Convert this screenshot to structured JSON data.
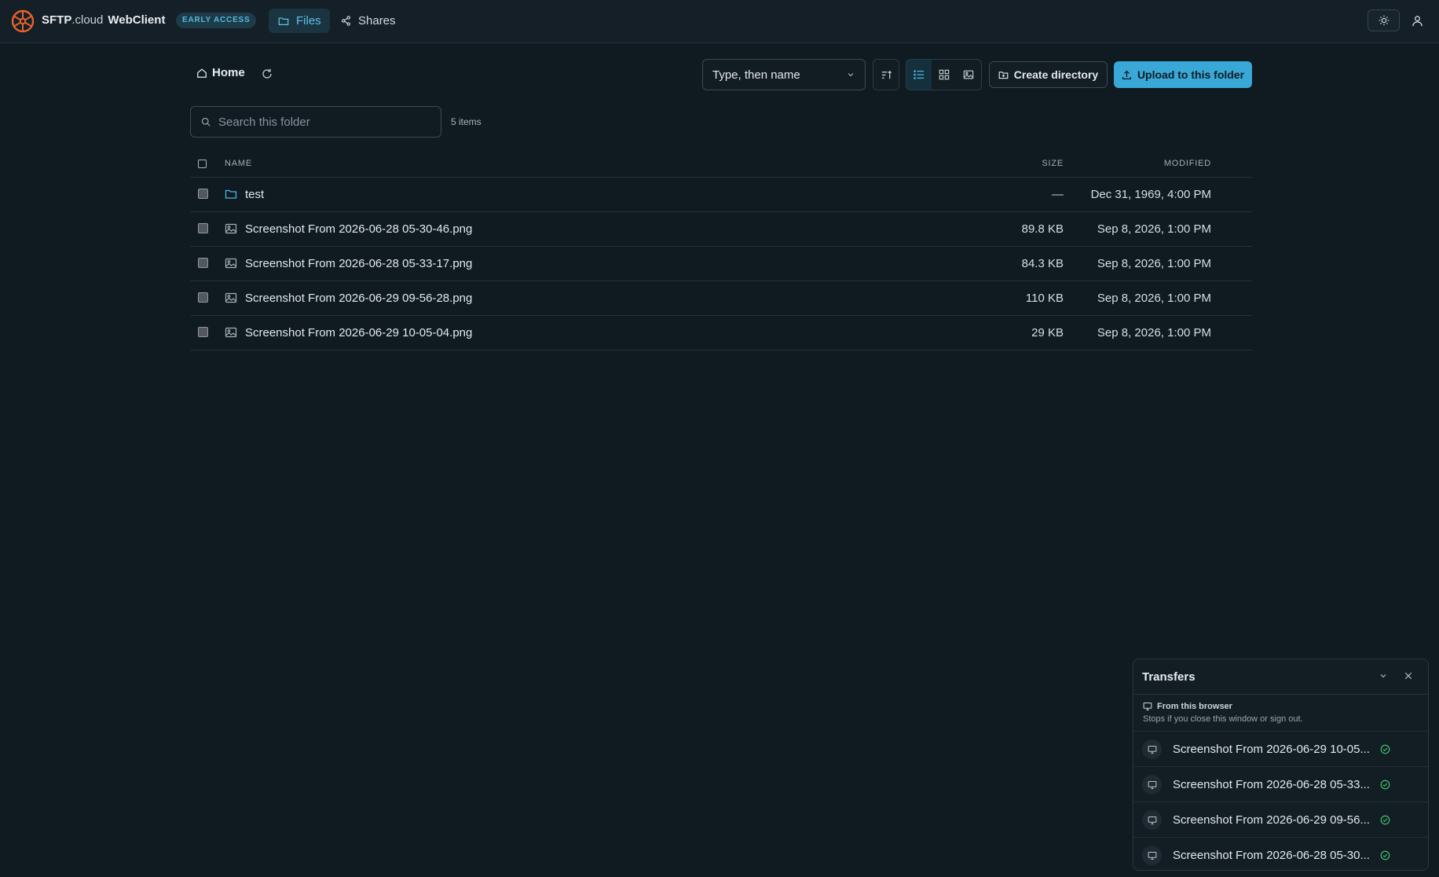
{
  "header": {
    "brand_bold": "SFTP",
    "brand_rest": ".cloud",
    "app_name": "WebClient",
    "badge": "EARLY ACCESS",
    "nav": {
      "files": "Files",
      "shares": "Shares"
    }
  },
  "toolbar": {
    "breadcrumb_home": "Home",
    "sort_value": "Type, then name",
    "create_directory": "Create directory",
    "upload": "Upload to this folder",
    "view_modes": [
      "list",
      "grid",
      "gallery"
    ],
    "active_view": "list"
  },
  "search": {
    "placeholder": "Search this folder",
    "item_count": "5 items"
  },
  "table": {
    "columns": {
      "name": "NAME",
      "size": "SIZE",
      "modified": "MODIFIED"
    },
    "rows": [
      {
        "type": "folder",
        "name": "test",
        "size": "—",
        "modified": "Dec 31, 1969, 4:00 PM"
      },
      {
        "type": "image",
        "name": "Screenshot From 2026-06-28 05-30-46.png",
        "size": "89.8 KB",
        "modified": "Sep 8, 2026, 1:00 PM"
      },
      {
        "type": "image",
        "name": "Screenshot From 2026-06-28 05-33-17.png",
        "size": "84.3 KB",
        "modified": "Sep 8, 2026, 1:00 PM"
      },
      {
        "type": "image",
        "name": "Screenshot From 2026-06-29 09-56-28.png",
        "size": "110 KB",
        "modified": "Sep 8, 2026, 1:00 PM"
      },
      {
        "type": "image",
        "name": "Screenshot From 2026-06-29 10-05-04.png",
        "size": "29 KB",
        "modified": "Sep 8, 2026, 1:00 PM"
      }
    ]
  },
  "transfers": {
    "title": "Transfers",
    "source_label": "From this browser",
    "source_note": "Stops if you close this window or sign out.",
    "items": [
      {
        "name": "Screenshot From 2026-06-29 10-05...",
        "status": "done"
      },
      {
        "name": "Screenshot From 2026-06-28 05-33...",
        "status": "done"
      },
      {
        "name": "Screenshot From 2026-06-29 09-56...",
        "status": "done"
      },
      {
        "name": "Screenshot From 2026-06-28 05-30...",
        "status": "done"
      }
    ]
  },
  "colors": {
    "accent": "#3aa8d6",
    "logo": "#e8622c",
    "success": "#3fbf6f",
    "background": "#0f1a21"
  }
}
